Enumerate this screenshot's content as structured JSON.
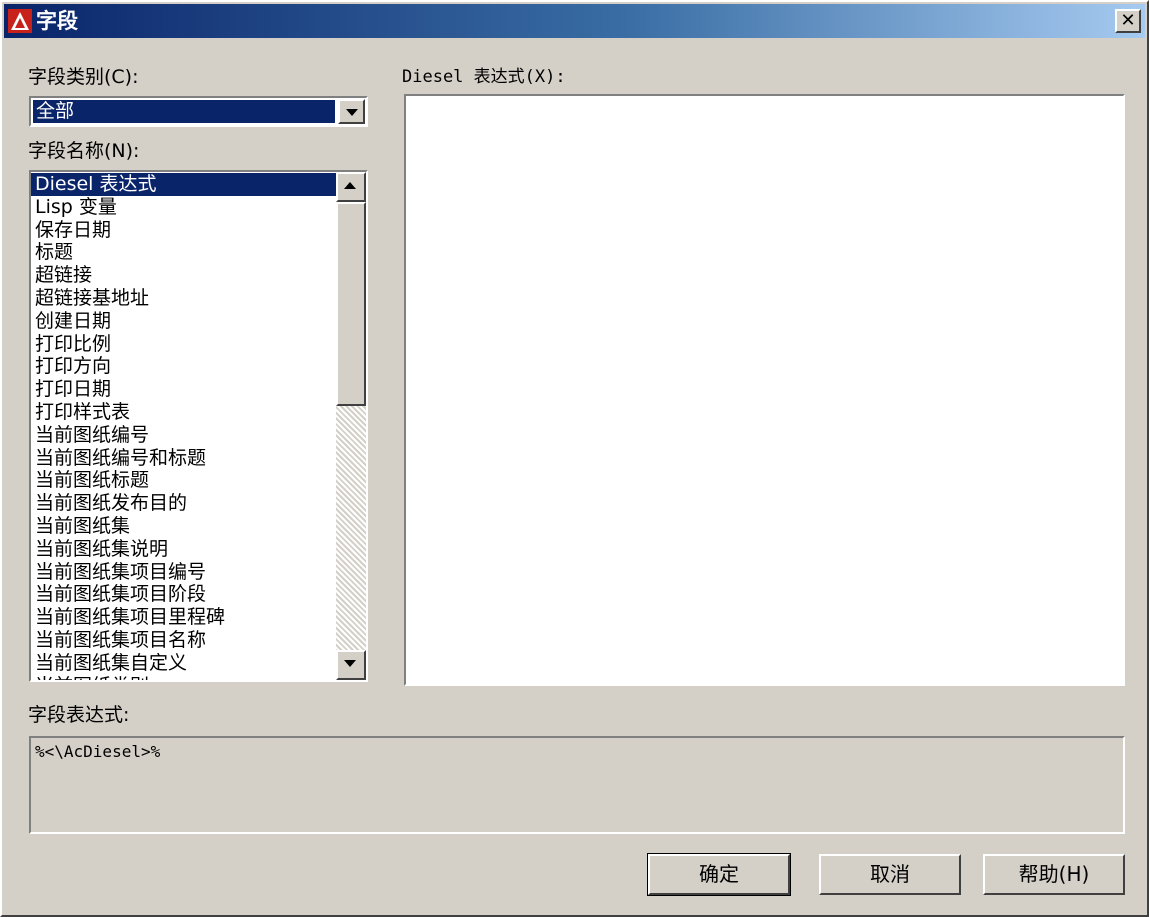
{
  "window": {
    "title": "字段",
    "close_glyph": "✕"
  },
  "category": {
    "label": "字段类别(C):",
    "selected": "全部"
  },
  "names": {
    "label": "字段名称(N):",
    "items": [
      "Diesel 表达式",
      "Lisp 变量",
      "保存日期",
      "标题",
      "超链接",
      "超链接基地址",
      "创建日期",
      "打印比例",
      "打印方向",
      "打印日期",
      "打印样式表",
      "当前图纸编号",
      "当前图纸编号和标题",
      "当前图纸标题",
      "当前图纸发布目的",
      "当前图纸集",
      "当前图纸集说明",
      "当前图纸集项目编号",
      "当前图纸集项目阶段",
      "当前图纸集项目里程碑",
      "当前图纸集项目名称",
      "当前图纸集自定义",
      "当前图纸类别"
    ]
  },
  "diesel": {
    "label": "Diesel 表达式(X):",
    "value": ""
  },
  "field_expression": {
    "label": "字段表达式:",
    "value": "%<\\AcDiesel>%"
  },
  "buttons": {
    "ok": "确定",
    "cancel": "取消",
    "help": "帮助(H)"
  },
  "colors": {
    "titlebar_start": "#0a246a",
    "titlebar_end": "#a6caf0",
    "selection": "#0a246a",
    "face": "#d4d0c8"
  }
}
